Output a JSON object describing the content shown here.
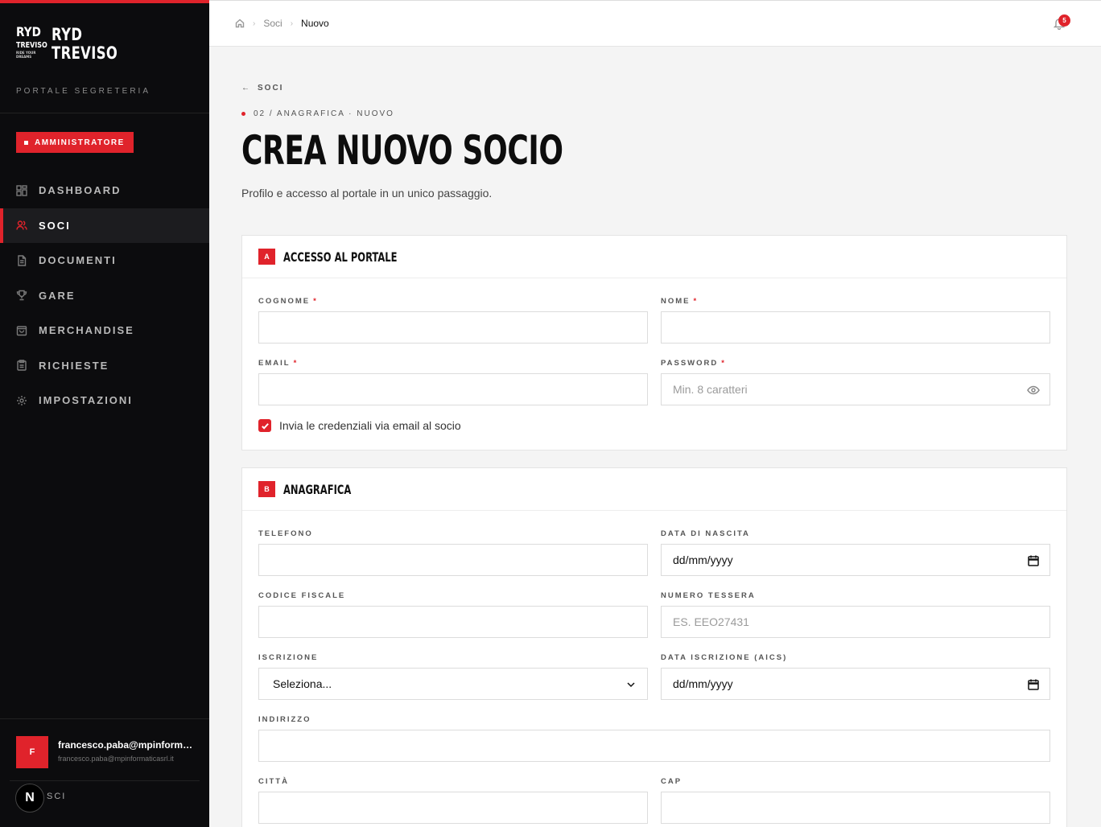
{
  "brand": {
    "logo_line1": "RYD",
    "logo_line2": "TREVISO",
    "logo_tagline": "RIDE YOUR DREAMS",
    "name_line1": "RYD",
    "name_line2": "TREVISO",
    "subtitle": "PORTALE SEGRETERIA",
    "accent": "#e0232b"
  },
  "role_badge": "AMMINISTRATORE",
  "nav": [
    {
      "label": "DASHBOARD",
      "icon": "grid-icon",
      "active": false
    },
    {
      "label": "SOCI",
      "icon": "users-icon",
      "active": true
    },
    {
      "label": "DOCUMENTI",
      "icon": "document-icon",
      "active": false
    },
    {
      "label": "GARE",
      "icon": "trophy-icon",
      "active": false
    },
    {
      "label": "MERCHANDISE",
      "icon": "bag-icon",
      "active": false
    },
    {
      "label": "RICHIESTE",
      "icon": "clipboard-icon",
      "active": false
    },
    {
      "label": "IMPOSTAZIONI",
      "icon": "gear-icon",
      "active": false
    }
  ],
  "user": {
    "initial": "F",
    "name": "francesco.paba@mpinformaticasrl.it",
    "email": "francesco.paba@mpinformaticasrl.it",
    "logout_label": "SCI",
    "next_badge": "N"
  },
  "breadcrumb": {
    "items": [
      "Soci",
      "Nuovo"
    ]
  },
  "notifications": {
    "count": "5"
  },
  "page": {
    "back_label": "SOCI",
    "kicker": "02 / ANAGRAFICA · NUOVO",
    "title": "CREA NUOVO SOCIO",
    "subtitle": "Profilo e accesso al portale in un unico passaggio."
  },
  "section_a": {
    "letter": "A",
    "title": "ACCESSO AL PORTALE",
    "cognome_label": "COGNOME",
    "nome_label": "NOME",
    "email_label": "EMAIL",
    "password_label": "PASSWORD",
    "password_placeholder": "Min. 8 caratteri",
    "required_mark": "*",
    "send_credentials_label": "Invia le credenziali via email al socio",
    "send_credentials_checked": true
  },
  "section_b": {
    "letter": "B",
    "title": "ANAGRAFICA",
    "telefono_label": "TELEFONO",
    "data_nascita_label": "DATA DI NASCITA",
    "data_nascita_value": "dd/mm/yyyy",
    "codice_fiscale_label": "CODICE FISCALE",
    "numero_tessera_label": "NUMERO TESSERA",
    "numero_tessera_placeholder": "ES. EEO27431",
    "iscrizione_label": "ISCRIZIONE",
    "iscrizione_value": "Seleziona...",
    "data_iscrizione_label": "DATA ISCRIZIONE (AICS)",
    "data_iscrizione_value": "dd/mm/yyyy",
    "indirizzo_label": "INDIRIZZO",
    "citta_label": "CITTÀ",
    "cap_label": "CAP"
  }
}
